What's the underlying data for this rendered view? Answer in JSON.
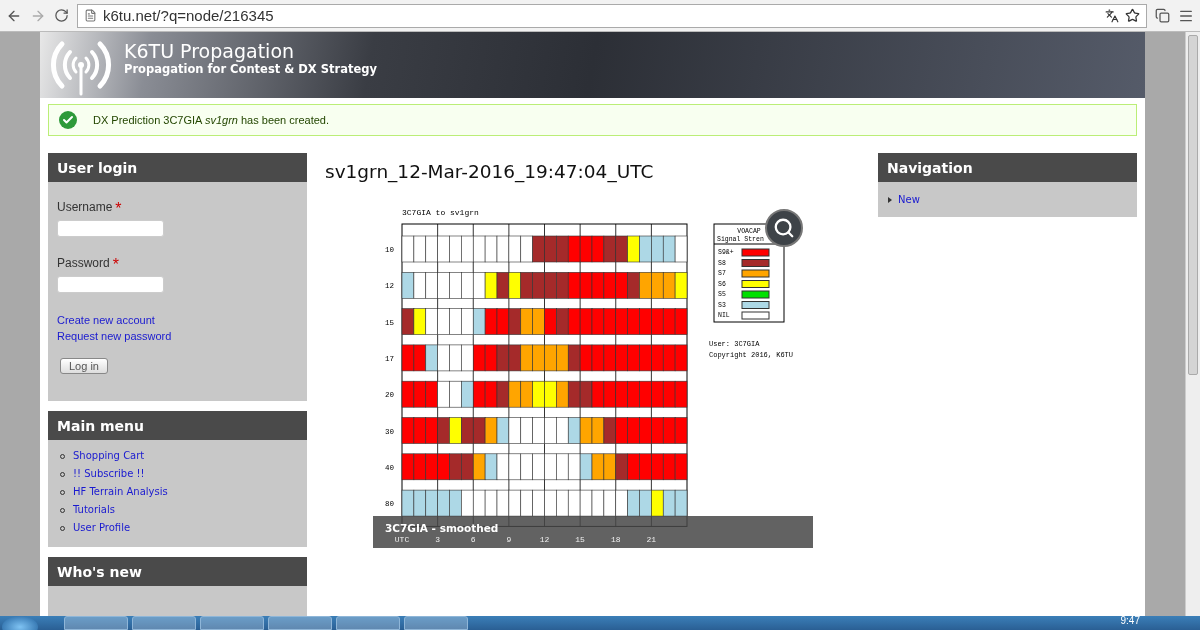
{
  "browser": {
    "url": "k6tu.net/?q=node/216345"
  },
  "site": {
    "name": "K6TU Propagation",
    "slogan": "Propagation for Contest & DX Strategy"
  },
  "message": {
    "text": "DX Prediction 3C7GIA *sv1grn* has been created."
  },
  "login": {
    "title": "User login",
    "username_label": "Username",
    "password_label": "Password",
    "required_mark": "*",
    "links": [
      "Create new account",
      "Request new password"
    ],
    "button": "Log in"
  },
  "main_menu": {
    "title": "Main menu",
    "items": [
      "Shopping Cart",
      "!! Subscribe !!",
      "HF Terrain Analysis",
      "Tutorials",
      "User Profile"
    ]
  },
  "whos_new": {
    "title": "Who's new"
  },
  "page_title": "sv1grn_12-Mar-2016_19:47:04_UTC",
  "prediction": {
    "title": "3C7GIA to sv1grn",
    "bands": [
      {
        "label": "10",
        "cells": [
          {
            "color": "#ffffff"
          },
          {
            "color": "#ffffff"
          },
          {
            "color": "#ffffff"
          },
          {
            "color": "#ffffff"
          },
          {
            "color": "#ffffff"
          },
          {
            "color": "#ffffff"
          },
          {
            "color": "#ffffff"
          },
          {
            "color": "#ffffff"
          },
          {
            "color": "#ffffff"
          },
          {
            "color": "#ffffff"
          },
          {
            "color": "#ffffff"
          },
          {
            "color": "#a52a2a"
          },
          {
            "color": "#a52a2a"
          },
          {
            "color": "#a52a2a"
          },
          {
            "color": "#ff0000"
          },
          {
            "color": "#ff0000"
          },
          {
            "color": "#ff0000"
          },
          {
            "color": "#a52a2a"
          },
          {
            "color": "#a52a2a"
          },
          {
            "color": "#ffff00"
          },
          {
            "color": "#add8e6"
          },
          {
            "color": "#add8e6"
          },
          {
            "color": "#add8e6"
          },
          {
            "color": "#ffffff"
          }
        ]
      },
      {
        "label": "12",
        "cells": [
          {
            "color": "#add8e6"
          },
          {
            "color": "#ffffff"
          },
          {
            "color": "#ffffff"
          },
          {
            "color": "#ffffff"
          },
          {
            "color": "#ffffff"
          },
          {
            "color": "#ffffff"
          },
          {
            "color": "#ffffff"
          },
          {
            "color": "#ffff00"
          },
          {
            "color": "#a52a2a"
          },
          {
            "color": "#ffff00"
          },
          {
            "color": "#a52a2a"
          },
          {
            "color": "#a52a2a"
          },
          {
            "color": "#a52a2a"
          },
          {
            "color": "#a52a2a"
          },
          {
            "color": "#ff0000"
          },
          {
            "color": "#ff0000"
          },
          {
            "color": "#ff0000"
          },
          {
            "color": "#ff0000"
          },
          {
            "color": "#ff0000"
          },
          {
            "color": "#a52a2a"
          },
          {
            "color": "#ffa500"
          },
          {
            "color": "#ffa500"
          },
          {
            "color": "#ffa500"
          },
          {
            "color": "#ffff00"
          }
        ]
      },
      {
        "label": "15",
        "cells": [
          {
            "color": "#a52a2a"
          },
          {
            "color": "#ffff00"
          },
          {
            "color": "#ffffff"
          },
          {
            "color": "#ffffff"
          },
          {
            "color": "#ffffff"
          },
          {
            "color": "#ffffff"
          },
          {
            "color": "#add8e6"
          },
          {
            "color": "#ff0000"
          },
          {
            "color": "#ff0000"
          },
          {
            "color": "#a52a2a"
          },
          {
            "color": "#ffa500"
          },
          {
            "color": "#ffa500"
          },
          {
            "color": "#ff0000"
          },
          {
            "color": "#a52a2a"
          },
          {
            "color": "#ff0000"
          },
          {
            "color": "#ff0000"
          },
          {
            "color": "#ff0000"
          },
          {
            "color": "#ff0000"
          },
          {
            "color": "#ff0000"
          },
          {
            "color": "#ff0000"
          },
          {
            "color": "#ff0000"
          },
          {
            "color": "#ff0000"
          },
          {
            "color": "#ff0000"
          },
          {
            "color": "#ff0000"
          }
        ]
      },
      {
        "label": "17",
        "cells": [
          {
            "color": "#ff0000"
          },
          {
            "color": "#ff0000"
          },
          {
            "color": "#add8e6"
          },
          {
            "color": "#ffffff"
          },
          {
            "color": "#ffffff"
          },
          {
            "color": "#ffffff"
          },
          {
            "color": "#ff0000"
          },
          {
            "color": "#ff0000"
          },
          {
            "color": "#a52a2a"
          },
          {
            "color": "#a52a2a"
          },
          {
            "color": "#ffa500"
          },
          {
            "color": "#ffa500"
          },
          {
            "color": "#ffa500"
          },
          {
            "color": "#ffa500"
          },
          {
            "color": "#a52a2a"
          },
          {
            "color": "#ff0000"
          },
          {
            "color": "#ff0000"
          },
          {
            "color": "#ff0000"
          },
          {
            "color": "#ff0000"
          },
          {
            "color": "#ff0000"
          },
          {
            "color": "#ff0000"
          },
          {
            "color": "#ff0000"
          },
          {
            "color": "#ff0000"
          },
          {
            "color": "#ff0000"
          }
        ]
      },
      {
        "label": "20",
        "cells": [
          {
            "color": "#ff0000"
          },
          {
            "color": "#ff0000"
          },
          {
            "color": "#ff0000"
          },
          {
            "color": "#ffffff"
          },
          {
            "color": "#ffffff"
          },
          {
            "color": "#add8e6"
          },
          {
            "color": "#ff0000"
          },
          {
            "color": "#ff0000"
          },
          {
            "color": "#a52a2a"
          },
          {
            "color": "#ffa500"
          },
          {
            "color": "#ffa500"
          },
          {
            "color": "#ffff00"
          },
          {
            "color": "#ffff00"
          },
          {
            "color": "#ffa500"
          },
          {
            "color": "#a52a2a"
          },
          {
            "color": "#a52a2a"
          },
          {
            "color": "#ff0000"
          },
          {
            "color": "#ff0000"
          },
          {
            "color": "#ff0000"
          },
          {
            "color": "#ff0000"
          },
          {
            "color": "#ff0000"
          },
          {
            "color": "#ff0000"
          },
          {
            "color": "#ff0000"
          },
          {
            "color": "#ff0000"
          }
        ]
      },
      {
        "label": "30",
        "cells": [
          {
            "color": "#ff0000"
          },
          {
            "color": "#ff0000"
          },
          {
            "color": "#ff0000"
          },
          {
            "color": "#a52a2a"
          },
          {
            "color": "#ffff00"
          },
          {
            "color": "#a52a2a"
          },
          {
            "color": "#a52a2a"
          },
          {
            "color": "#ffa500"
          },
          {
            "color": "#add8e6"
          },
          {
            "color": "#ffffff"
          },
          {
            "color": "#ffffff"
          },
          {
            "color": "#ffffff"
          },
          {
            "color": "#ffffff"
          },
          {
            "color": "#ffffff"
          },
          {
            "color": "#add8e6"
          },
          {
            "color": "#ffa500"
          },
          {
            "color": "#ffa500"
          },
          {
            "color": "#a52a2a"
          },
          {
            "color": "#ff0000"
          },
          {
            "color": "#ff0000"
          },
          {
            "color": "#ff0000"
          },
          {
            "color": "#ff0000"
          },
          {
            "color": "#ff0000"
          },
          {
            "color": "#ff0000"
          }
        ]
      },
      {
        "label": "40",
        "cells": [
          {
            "color": "#ff0000"
          },
          {
            "color": "#ff0000"
          },
          {
            "color": "#ff0000"
          },
          {
            "color": "#ff0000"
          },
          {
            "color": "#a52a2a"
          },
          {
            "color": "#a52a2a"
          },
          {
            "color": "#ffa500"
          },
          {
            "color": "#add8e6"
          },
          {
            "color": "#ffffff"
          },
          {
            "color": "#ffffff"
          },
          {
            "color": "#ffffff"
          },
          {
            "color": "#ffffff"
          },
          {
            "color": "#ffffff"
          },
          {
            "color": "#ffffff"
          },
          {
            "color": "#ffffff"
          },
          {
            "color": "#add8e6"
          },
          {
            "color": "#ffa500"
          },
          {
            "color": "#ffa500"
          },
          {
            "color": "#a52a2a"
          },
          {
            "color": "#ff0000"
          },
          {
            "color": "#ff0000"
          },
          {
            "color": "#ff0000"
          },
          {
            "color": "#ff0000"
          },
          {
            "color": "#ff0000"
          }
        ]
      },
      {
        "label": "80",
        "cells": [
          {
            "color": "#add8e6"
          },
          {
            "color": "#add8e6"
          },
          {
            "color": "#add8e6"
          },
          {
            "color": "#add8e6"
          },
          {
            "color": "#add8e6"
          },
          {
            "color": "#ffffff"
          },
          {
            "color": "#ffffff"
          },
          {
            "color": "#ffffff"
          },
          {
            "color": "#ffffff"
          },
          {
            "color": "#ffffff"
          },
          {
            "color": "#ffffff"
          },
          {
            "color": "#ffffff"
          },
          {
            "color": "#ffffff"
          },
          {
            "color": "#ffffff"
          },
          {
            "color": "#ffffff"
          },
          {
            "color": "#ffffff"
          },
          {
            "color": "#ffffff"
          },
          {
            "color": "#ffffff"
          },
          {
            "color": "#ffffff"
          },
          {
            "color": "#add8e6"
          },
          {
            "color": "#add8e6"
          },
          {
            "color": "#ffff00"
          },
          {
            "color": "#add8e6"
          },
          {
            "color": "#add8e6"
          }
        ]
      }
    ],
    "hours": [
      "UTC",
      "3",
      "6",
      "9",
      "12",
      "15",
      "18",
      "21"
    ],
    "legend": {
      "title": "VOACAP",
      "subtitle": "Signal Stren",
      "items": [
        {
          "label": "S9&+",
          "color": "#ff0000"
        },
        {
          "label": "S8",
          "color": "#a52a2a"
        },
        {
          "label": "S7",
          "color": "#ffa500"
        },
        {
          "label": "S6",
          "color": "#ffff00"
        },
        {
          "label": "S5",
          "color": "#00e000"
        },
        {
          "label": "S3",
          "color": "#add8e6"
        },
        {
          "label": "NIL",
          "color": "#ffffff"
        }
      ]
    },
    "user": "User: 3C7GIA",
    "copyright": "Copyright 2016, K6TU",
    "caption": "3C7GIA - smoothed"
  },
  "navigation": {
    "title": "Navigation",
    "items": [
      "New"
    ]
  },
  "taskbar": {
    "clock": "9:47"
  }
}
